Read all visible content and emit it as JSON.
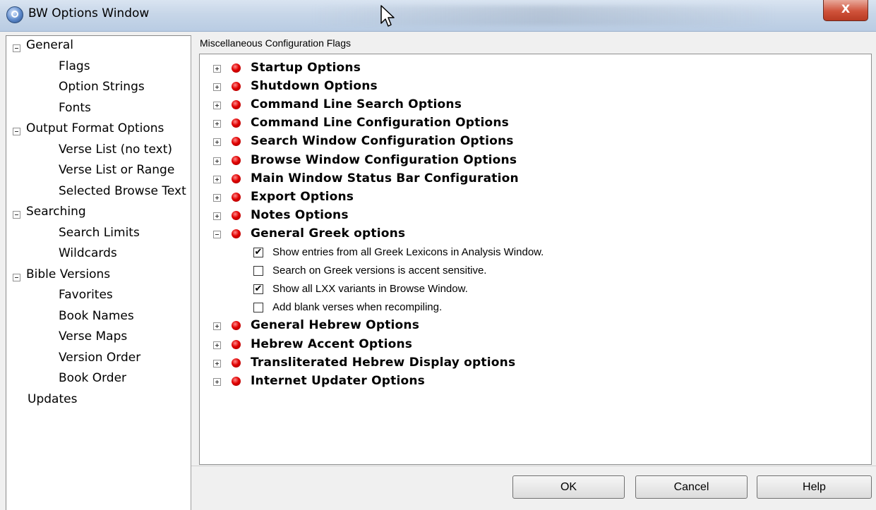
{
  "window": {
    "title": "BW Options Window",
    "close_label": "X"
  },
  "nav": {
    "items": [
      {
        "label": "General",
        "level": 0,
        "expanded": true
      },
      {
        "label": "Flags",
        "level": 1
      },
      {
        "label": "Option Strings",
        "level": 1
      },
      {
        "label": "Fonts",
        "level": 1
      },
      {
        "label": "Output Format Options",
        "level": 0,
        "expanded": true
      },
      {
        "label": "Verse List (no text)",
        "level": 1
      },
      {
        "label": "Verse List or Range",
        "level": 1
      },
      {
        "label": "Selected Browse Text",
        "level": 1
      },
      {
        "label": "Searching",
        "level": 0,
        "expanded": true
      },
      {
        "label": "Search Limits",
        "level": 1
      },
      {
        "label": "Wildcards",
        "level": 1
      },
      {
        "label": "Bible Versions",
        "level": 0,
        "expanded": true
      },
      {
        "label": "Favorites",
        "level": 1
      },
      {
        "label": "Book Names",
        "level": 1
      },
      {
        "label": "Verse Maps",
        "level": 1
      },
      {
        "label": "Version Order",
        "level": 1
      },
      {
        "label": "Book Order",
        "level": 1
      },
      {
        "label": "Updates",
        "level": 0
      }
    ]
  },
  "panel": {
    "group_label": "Miscellaneous Configuration Flags",
    "groups": [
      {
        "label": "Startup Options",
        "expanded": false
      },
      {
        "label": "Shutdown Options",
        "expanded": false
      },
      {
        "label": "Command Line Search Options",
        "expanded": false
      },
      {
        "label": "Command Line Configuration Options",
        "expanded": false
      },
      {
        "label": "Search Window Configuration Options",
        "expanded": false
      },
      {
        "label": "Browse Window Configuration Options",
        "expanded": false
      },
      {
        "label": "Main Window Status Bar Configuration",
        "expanded": false
      },
      {
        "label": "Export Options",
        "expanded": false
      },
      {
        "label": "Notes Options",
        "expanded": false
      },
      {
        "label": "General Greek options",
        "expanded": true
      },
      {
        "label": "General Hebrew Options",
        "expanded": false
      },
      {
        "label": "Hebrew Accent Options",
        "expanded": false
      },
      {
        "label": "Transliterated Hebrew Display options",
        "expanded": false
      },
      {
        "label": "Internet Updater Options",
        "expanded": false
      }
    ],
    "greek_options": [
      {
        "label": "Show entries from all Greek Lexicons in Analysis Window.",
        "checked": true
      },
      {
        "label": "Search on Greek versions is accent sensitive.",
        "checked": false
      },
      {
        "label": "Show all LXX variants in Browse Window.",
        "checked": true
      },
      {
        "label": "Add blank verses when recompiling.",
        "checked": false
      }
    ]
  },
  "buttons": {
    "ok": "OK",
    "cancel": "Cancel",
    "help": "Help"
  },
  "colors": {
    "bullet": "#e00000",
    "close": "#c9452d",
    "titlebar": "#c7d6e8"
  }
}
